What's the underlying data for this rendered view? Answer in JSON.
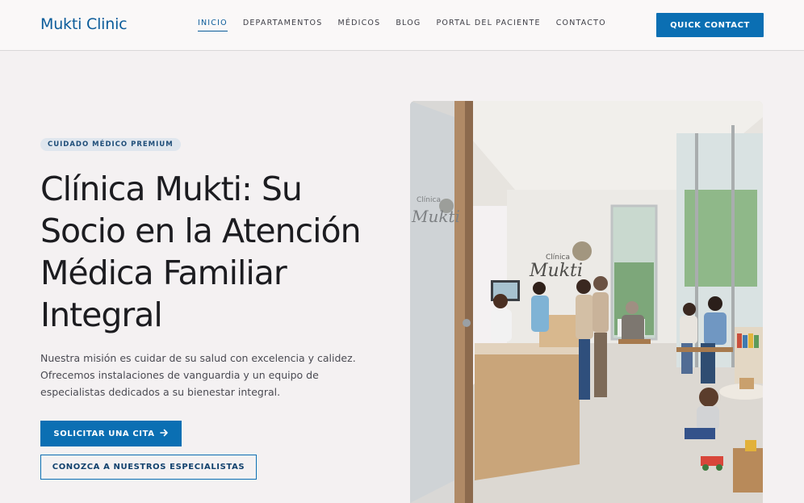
{
  "header": {
    "logo": "Mukti Clinic",
    "nav": [
      {
        "label": "INICIO",
        "active": true
      },
      {
        "label": "DEPARTAMENTOS",
        "active": false
      },
      {
        "label": "MÉDICOS",
        "active": false
      },
      {
        "label": "BLOG",
        "active": false
      },
      {
        "label": "PORTAL DEL PACIENTE",
        "active": false
      },
      {
        "label": "CONTACTO",
        "active": false
      }
    ],
    "quick_contact": "QUICK CONTACT"
  },
  "hero": {
    "badge": "CUIDADO MÉDICO PREMIUM",
    "title": "Clínica Mukti: Su Socio en la Atención Médica Familiar Integral",
    "description": "Nuestra misión es cuidar de su salud con excelencia y calidez. Ofrecemos instalaciones de vanguardia y un equipo de especialistas dedicados a su bienestar integral.",
    "cta_primary": "SOLICITAR UNA CITA",
    "cta_primary_icon": "arrow-right-icon",
    "cta_secondary": "CONOZCA A NUESTROS ESPECIALISTAS",
    "image": {
      "door_logo_line1": "Clínica",
      "door_logo_line2": "Mukti",
      "wall_logo_line1": "Clínica",
      "wall_logo_line2": "Mukti"
    }
  },
  "colors": {
    "brand_blue": "#0b6fb3",
    "logo_blue": "#0b5c9a",
    "page_bg": "#f4f1f2",
    "badge_bg": "#dfe6ee"
  }
}
